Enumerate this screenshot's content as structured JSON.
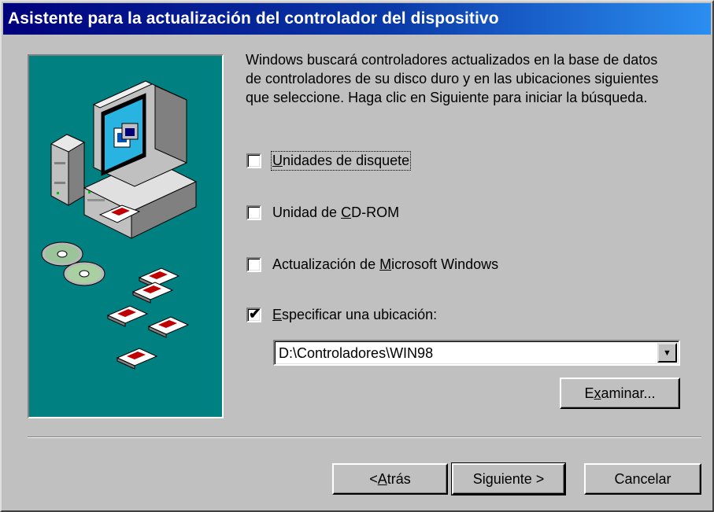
{
  "window": {
    "title": "Asistente para la actualización del controlador del dispositivo"
  },
  "intro": "Windows buscará controladores actualizados en la base de datos de controladores de su disco duro y en las ubicaciones siguientes que seleccione. Haga clic en Siguiente para iniciar la búsqueda.",
  "options": [
    {
      "pre": "",
      "accel": "U",
      "post": "nidades de disquete",
      "checked": false
    },
    {
      "pre": "Unidad de ",
      "accel": "C",
      "post": "D-ROM",
      "checked": false
    },
    {
      "pre": "Actualización de ",
      "accel": "M",
      "post": "icrosoft Windows",
      "checked": false
    },
    {
      "pre": "",
      "accel": "E",
      "post": "specificar una ubicación:",
      "checked": true
    }
  ],
  "location": {
    "value": "D:\\Controladores\\WIN98"
  },
  "buttons": {
    "browse": {
      "pre": "E",
      "accel": "x",
      "post": "aminar..."
    },
    "back": {
      "pre": "< ",
      "accel": "A",
      "post": "trás"
    },
    "next": {
      "label": "Siguiente >"
    },
    "cancel": {
      "label": "Cancelar"
    }
  },
  "colors": {
    "title_start": "#00007c",
    "title_end": "#2b8ef0",
    "panel": "#008080",
    "face": "#c0c0c0"
  }
}
